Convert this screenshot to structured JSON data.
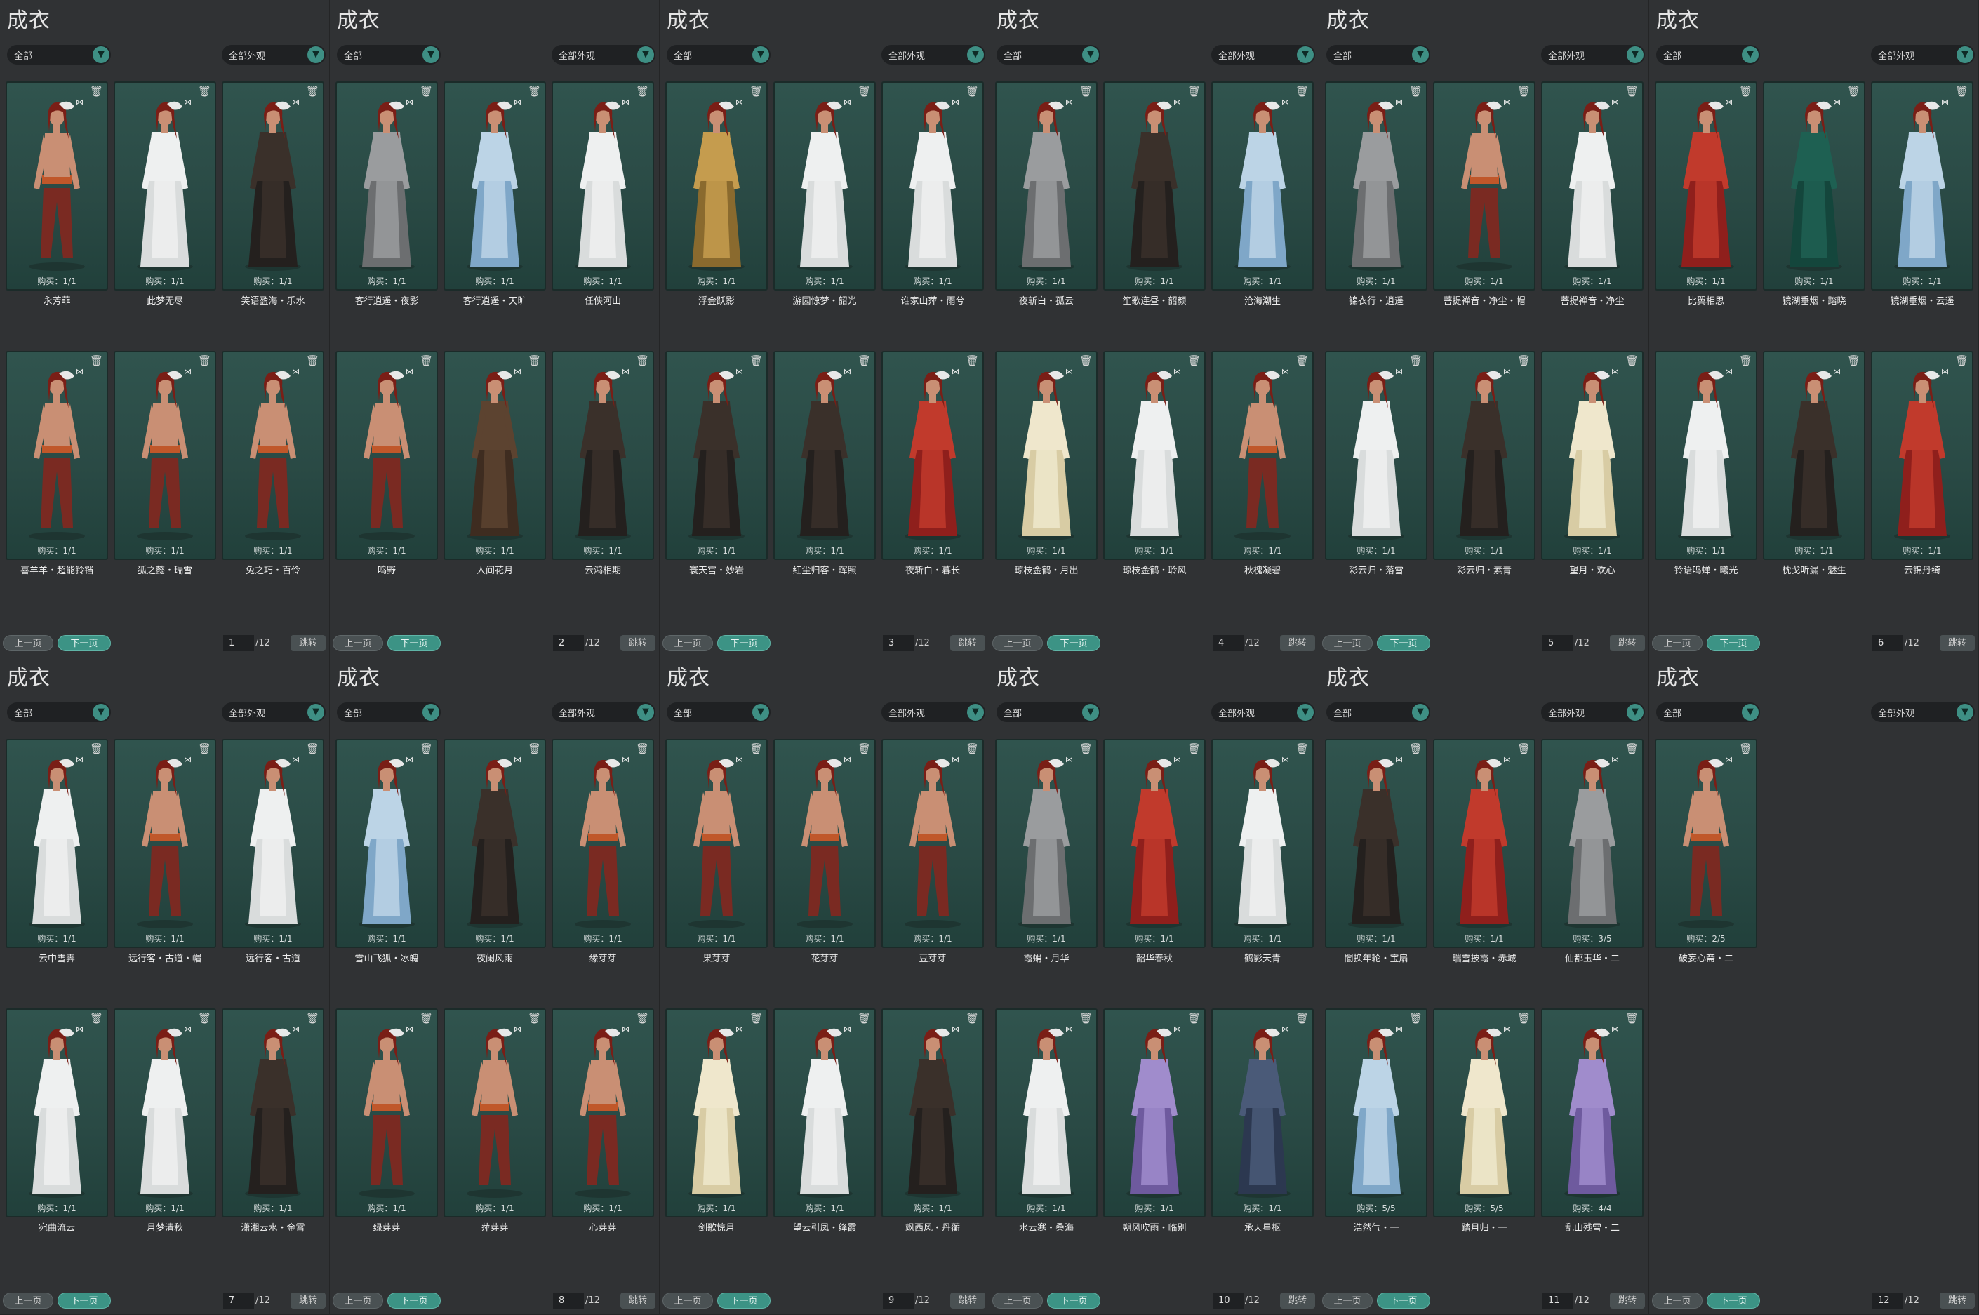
{
  "window_title": "成衣",
  "filter_all": "全部",
  "filter_appearance": "全部外观",
  "prev_label": "上一页",
  "next_label": "下一页",
  "jump_label": "跳转",
  "total_pages": "/12",
  "arrow_icon": "chevron-down-icon",
  "trash_icon": "trash-icon",
  "butterfly_icon": "butterfly-icon",
  "colors": {
    "accent": "#3c9385",
    "card_bg": "#2a4a45",
    "panel_bg": "#303234"
  },
  "panels": [
    {
      "page": "1",
      "items": [
        {
          "name": "永芳菲",
          "buy": "购买：1/1",
          "outfit": "bare"
        },
        {
          "name": "此梦无尽",
          "buy": "购买：1/1",
          "outfit": "white"
        },
        {
          "name": "笑语盈海・乐水",
          "buy": "购买：1/1",
          "outfit": "dark"
        },
        {
          "name": "喜羊羊・超能铃铛",
          "buy": "购买：1/1",
          "outfit": "bare"
        },
        {
          "name": "狐之懿・瑞雪",
          "buy": "购买：1/1",
          "outfit": "bare"
        },
        {
          "name": "兔之巧・百伶",
          "buy": "购买：1/1",
          "outfit": "bare"
        }
      ]
    },
    {
      "page": "2",
      "items": [
        {
          "name": "客行逍遥・夜影",
          "buy": "购买：1/1",
          "outfit": "grey"
        },
        {
          "name": "客行逍遥・天旷",
          "buy": "购买：1/1",
          "outfit": "blue"
        },
        {
          "name": "任侠河山",
          "buy": "购买：1/1",
          "outfit": "white"
        },
        {
          "name": "鸣野",
          "buy": "购买：1/1",
          "outfit": "bare"
        },
        {
          "name": "人间花月",
          "buy": "购买：1/1",
          "outfit": "brown"
        },
        {
          "name": "云鸿相期",
          "buy": "购买：1/1",
          "outfit": "dark"
        }
      ]
    },
    {
      "page": "3",
      "items": [
        {
          "name": "浮金跃影",
          "buy": "购买：1/1",
          "outfit": "gold"
        },
        {
          "name": "游园惊梦・韶光",
          "buy": "购买：1/1",
          "outfit": "white"
        },
        {
          "name": "谁家山萍・雨兮",
          "buy": "购买：1/1",
          "outfit": "white"
        },
        {
          "name": "寰天宫・妙岩",
          "buy": "购买：1/1",
          "outfit": "dark"
        },
        {
          "name": "红尘归客・晖照",
          "buy": "购买：1/1",
          "outfit": "dark"
        },
        {
          "name": "夜斩白・暮长",
          "buy": "购买：1/1",
          "outfit": "red"
        }
      ]
    },
    {
      "page": "4",
      "items": [
        {
          "name": "夜斩白・孤云",
          "buy": "购买：1/1",
          "outfit": "grey"
        },
        {
          "name": "笙歌连昼・韶颜",
          "buy": "购买：1/1",
          "outfit": "dark"
        },
        {
          "name": "沧海潮生",
          "buy": "购买：1/1",
          "outfit": "blue"
        },
        {
          "name": "琼枝金鹤・月出",
          "buy": "购买：1/1",
          "outfit": "cream"
        },
        {
          "name": "琼枝金鹤・聆风",
          "buy": "购买：1/1",
          "outfit": "white"
        },
        {
          "name": "秋槐凝碧",
          "buy": "购买：1/1",
          "outfit": "bare"
        }
      ]
    },
    {
      "page": "5",
      "items": [
        {
          "name": "锦衣行・逍遥",
          "buy": "购买：1/1",
          "outfit": "grey"
        },
        {
          "name": "菩提禅音・净尘・帽",
          "buy": "购买：1/1",
          "outfit": "bare"
        },
        {
          "name": "菩提禅音・净尘",
          "buy": "购买：1/1",
          "outfit": "white"
        },
        {
          "name": "彩云归・落雪",
          "buy": "购买：1/1",
          "outfit": "white"
        },
        {
          "name": "彩云归・素青",
          "buy": "购买：1/1",
          "outfit": "dark"
        },
        {
          "name": "望月・欢心",
          "buy": "购买：1/1",
          "outfit": "cream"
        }
      ]
    },
    {
      "page": "6",
      "items": [
        {
          "name": "比翼相思",
          "buy": "购买：1/1",
          "outfit": "red"
        },
        {
          "name": "镜湖垂烟・踏晓",
          "buy": "购买：1/1",
          "outfit": "green"
        },
        {
          "name": "镜湖垂烟・云遥",
          "buy": "购买：1/1",
          "outfit": "blue"
        },
        {
          "name": "铃语鸣蝉・曦光",
          "buy": "购买：1/1",
          "outfit": "white"
        },
        {
          "name": "枕戈听漏・魅生",
          "buy": "购买：1/1",
          "outfit": "dark"
        },
        {
          "name": "云锦丹绮",
          "buy": "购买：1/1",
          "outfit": "red"
        }
      ]
    },
    {
      "page": "7",
      "items": [
        {
          "name": "云中雪霁",
          "buy": "购买：1/1",
          "outfit": "white"
        },
        {
          "name": "远行客・古道・帽",
          "buy": "购买：1/1",
          "outfit": "bare"
        },
        {
          "name": "远行客・古道",
          "buy": "购买：1/1",
          "outfit": "white"
        },
        {
          "name": "宛曲流云",
          "buy": "购买：1/1",
          "outfit": "white"
        },
        {
          "name": "月梦清秋",
          "buy": "购买：1/1",
          "outfit": "white"
        },
        {
          "name": "潇湘云水・金霄",
          "buy": "购买：1/1",
          "outfit": "dark"
        }
      ]
    },
    {
      "page": "8",
      "items": [
        {
          "name": "雪山飞狐・冰魄",
          "buy": "购买：1/1",
          "outfit": "blue"
        },
        {
          "name": "夜阑风雨",
          "buy": "购买：1/1",
          "outfit": "dark"
        },
        {
          "name": "缘芽芽",
          "buy": "购买：1/1",
          "outfit": "bare"
        },
        {
          "name": "绿芽芽",
          "buy": "购买：1/1",
          "outfit": "bare"
        },
        {
          "name": "萍芽芽",
          "buy": "购买：1/1",
          "outfit": "bare"
        },
        {
          "name": "心芽芽",
          "buy": "购买：1/1",
          "outfit": "bare"
        }
      ]
    },
    {
      "page": "9",
      "items": [
        {
          "name": "果芽芽",
          "buy": "购买：1/1",
          "outfit": "bare"
        },
        {
          "name": "花芽芽",
          "buy": "购买：1/1",
          "outfit": "bare"
        },
        {
          "name": "豆芽芽",
          "buy": "购买：1/1",
          "outfit": "bare"
        },
        {
          "name": "剑歌惊月",
          "buy": "购买：1/1",
          "outfit": "cream"
        },
        {
          "name": "望云引凤・绛霞",
          "buy": "购买：1/1",
          "outfit": "white"
        },
        {
          "name": "飒西风・丹蘅",
          "buy": "购买：1/1",
          "outfit": "dark"
        }
      ]
    },
    {
      "page": "10",
      "items": [
        {
          "name": "霞蛸・月华",
          "buy": "购买：1/1",
          "outfit": "grey"
        },
        {
          "name": "韶华春秋",
          "buy": "购买：1/1",
          "outfit": "red"
        },
        {
          "name": "鹤影天青",
          "buy": "购买：1/1",
          "outfit": "white"
        },
        {
          "name": "水云寒・桑海",
          "buy": "购买：1/1",
          "outfit": "white"
        },
        {
          "name": "朔风吹雨・临别",
          "buy": "购买：1/1",
          "outfit": "purple"
        },
        {
          "name": "承天星枢",
          "buy": "购买：1/1",
          "outfit": "navy"
        }
      ]
    },
    {
      "page": "11",
      "items": [
        {
          "name": "闇换年轮・宝扇",
          "buy": "购买：1/1",
          "outfit": "dark"
        },
        {
          "name": "瑞雪披霞・赤城",
          "buy": "购买：1/1",
          "outfit": "red"
        },
        {
          "name": "仙都玉华・二",
          "buy": "购买：3/5",
          "outfit": "grey"
        },
        {
          "name": "浩然气・一",
          "buy": "购买：5/5",
          "outfit": "blue"
        },
        {
          "name": "踏月归・一",
          "buy": "购买：5/5",
          "outfit": "cream"
        },
        {
          "name": "乱山残雪・二",
          "buy": "购买：4/4",
          "outfit": "purple"
        }
      ]
    },
    {
      "page": "12",
      "items": [
        {
          "name": "破妄心斋・二",
          "buy": "购买：2/5",
          "outfit": "bare"
        }
      ]
    }
  ]
}
